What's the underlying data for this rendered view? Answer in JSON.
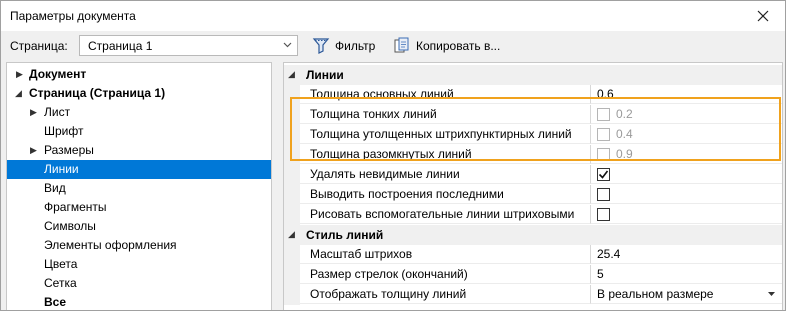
{
  "window": {
    "title": "Параметры документа"
  },
  "toolbar": {
    "page_label": "Страница:",
    "page_value": "Страница 1",
    "filter_label": "Фильтр",
    "copy_label": "Копировать в..."
  },
  "tree": [
    {
      "label": "Документ",
      "bold": true,
      "expander": "collapsed"
    },
    {
      "label": "Страница (Страница 1)",
      "bold": true,
      "expander": "expanded"
    },
    {
      "label": "Лист",
      "expander": "collapsed"
    },
    {
      "label": "Шрифт"
    },
    {
      "label": "Размеры",
      "expander": "collapsed"
    },
    {
      "label": "Линии",
      "selected": true
    },
    {
      "label": "Вид"
    },
    {
      "label": "Фрагменты"
    },
    {
      "label": "Символы"
    },
    {
      "label": "Элементы оформления"
    },
    {
      "label": "Цвета"
    },
    {
      "label": "Сетка"
    },
    {
      "label": "Все",
      "bold": true
    }
  ],
  "properties": {
    "lines_category": "Линии",
    "main_thickness_label": "Толщина основных линий",
    "main_thickness_value": "0.6",
    "thin_thickness_label": "Толщина тонких линий",
    "thin_thickness_value": "0.2",
    "thick_dash_label": "Толщина утолщенных штрихпунктирных линий",
    "thick_dash_value": "0.4",
    "open_label": "Толщина разомкнутых линий",
    "open_value": "0.9",
    "remove_invisible_label": "Удалять невидимые линии",
    "output_last_label": "Выводить построения последними",
    "draw_aux_label": "Рисовать вспомогательные линии штриховыми",
    "style_category": "Стиль линий",
    "hatch_scale_label": "Масштаб штрихов",
    "hatch_scale_value": "25.4",
    "arrow_size_label": "Размер стрелок (окончаний)",
    "arrow_size_value": "5",
    "display_thickness_label": "Отображать толщину линий",
    "display_thickness_value": "В реальном размере"
  },
  "accent": {
    "selection": "#0078d7",
    "highlight": "#f0a21d"
  }
}
